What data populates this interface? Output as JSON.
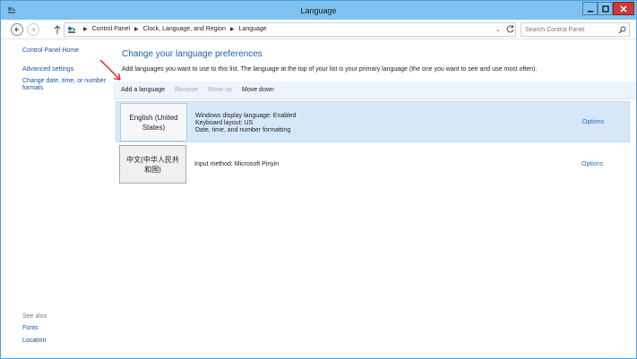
{
  "window": {
    "title": "Language",
    "accent_color": "#7fc2ef",
    "close_color": "#c93b3b"
  },
  "address_bar": {
    "breadcrumbs": [
      "Control Panel",
      "Clock, Language, and Region",
      "Language"
    ],
    "search_placeholder": "Search Control Panel"
  },
  "sidebar": {
    "home": "Control Panel Home",
    "links": [
      "Advanced settings",
      "Change date, time, or number formats"
    ],
    "see_also_title": "See also",
    "see_also": [
      "Fonts",
      "Location"
    ]
  },
  "main": {
    "heading": "Change your language preferences",
    "description": "Add languages you want to use to this list. The language at the top of your list is your primary language (the one you want to see and use most often).",
    "toolbar": {
      "add": "Add a language",
      "remove": "Remove",
      "move_up": "Move up",
      "move_down": "Move down"
    },
    "languages": [
      {
        "name": "English (United States)",
        "details": [
          "Windows display language: Enabled",
          "Keyboard layout: US",
          "Date, time, and number formatting"
        ],
        "options": "Options",
        "selected": true
      },
      {
        "name": "中文(中华人民共和国)",
        "details": [
          "Input method: Microsoft Pinyin"
        ],
        "options": "Options",
        "selected": false
      }
    ]
  },
  "annotation": {
    "arrow_color": "#e02020"
  }
}
